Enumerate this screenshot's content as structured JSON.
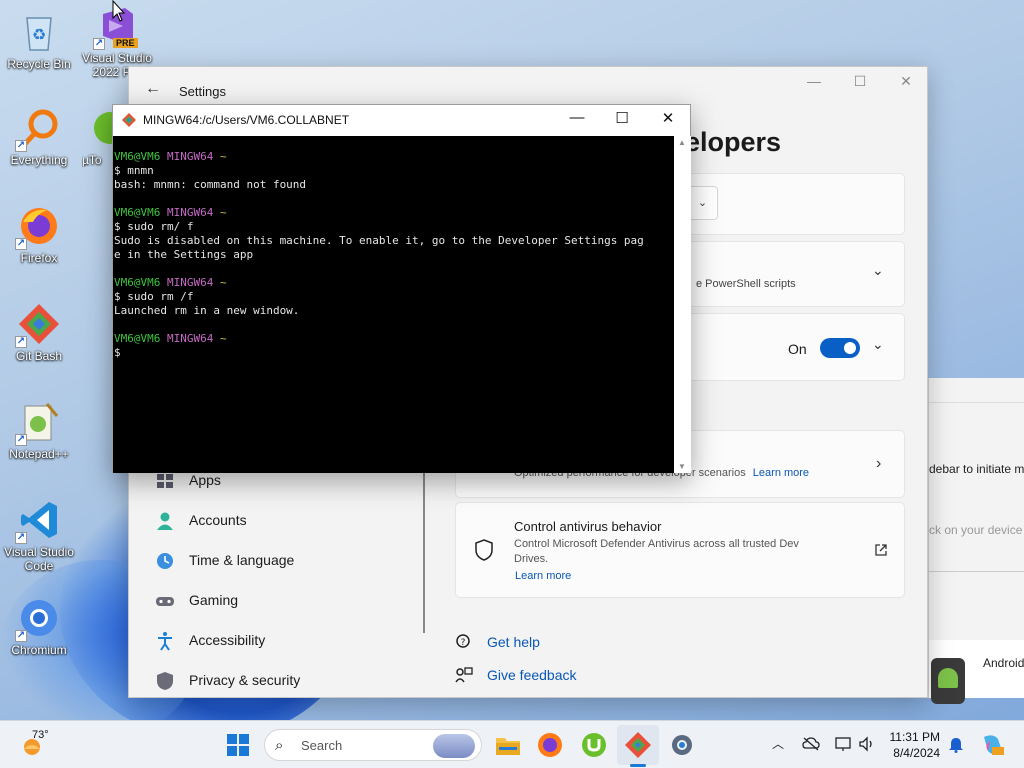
{
  "desktop": {
    "icons": [
      {
        "label": "Recycle Bin",
        "icon": "recycle-bin-icon"
      },
      {
        "label": "Visual Studio 2022 Pre",
        "icon": "visual-studio-2022-icon",
        "badge": "PRE"
      },
      {
        "label": "Everything",
        "icon": "everything-search-icon"
      },
      {
        "label": "µTo",
        "icon": "utorrent-icon"
      },
      {
        "label": "Firefox",
        "icon": "firefox-icon"
      },
      {
        "label": "Git Bash",
        "icon": "git-bash-icon"
      },
      {
        "label": "Notepad++",
        "icon": "notepad-plus-plus-icon"
      },
      {
        "label": "Visual Studio Code",
        "icon": "vscode-icon"
      },
      {
        "label": "Chromium",
        "icon": "chromium-icon"
      }
    ]
  },
  "settings": {
    "title": "Settings",
    "heading": "elopers",
    "cards": {
      "scripts_text": "e PowerShell scripts",
      "toggle_state": "On",
      "devdrive_desc": "Optimized performance for developer scenarios",
      "learn_more": "Learn more",
      "antivirus_title": "Control antivirus behavior",
      "antivirus_desc_1": "Control Microsoft Defender Antivirus across all trusted Dev",
      "antivirus_desc_2": "Drives.",
      "antivirus_learn_more": "Learn more"
    },
    "nav": [
      {
        "label": "Apps",
        "icon": "apps-icon"
      },
      {
        "label": "Accounts",
        "icon": "accounts-icon"
      },
      {
        "label": "Time & language",
        "icon": "time-language-icon"
      },
      {
        "label": "Gaming",
        "icon": "gaming-icon"
      },
      {
        "label": "Accessibility",
        "icon": "accessibility-icon"
      },
      {
        "label": "Privacy & security",
        "icon": "privacy-shield-icon"
      }
    ],
    "help": {
      "get_help": "Get help",
      "give_feedback": "Give feedback"
    }
  },
  "background_window": {
    "text_1": "debar to initiate m",
    "text_2": "ck on your device",
    "text_3": "Android"
  },
  "terminal": {
    "title": "MINGW64:/c/Users/VM6.COLLABNET",
    "lines": [
      {
        "user": "VM6@VM6",
        "env": "MINGW64",
        "path": "~"
      },
      {
        "text": "$ mnmn"
      },
      {
        "text": "bash: mnmn: command not found"
      },
      {
        "text": ""
      },
      {
        "user": "VM6@VM6",
        "env": "MINGW64",
        "path": "~"
      },
      {
        "text": "$ sudo rm/ f"
      },
      {
        "text": "Sudo is disabled on this machine. To enable it, go to the Developer Settings pag"
      },
      {
        "text": "e in the Settings app"
      },
      {
        "text": ""
      },
      {
        "user": "VM6@VM6",
        "env": "MINGW64",
        "path": "~"
      },
      {
        "text": "$ sudo rm /f"
      },
      {
        "text": "Launched rm in a new window."
      },
      {
        "text": ""
      },
      {
        "user": "VM6@VM6",
        "env": "MINGW64",
        "path": "~"
      },
      {
        "text": "$"
      }
    ]
  },
  "taskbar": {
    "weather": "73°",
    "search_placeholder": "Search",
    "time": "11:31 PM",
    "date": "8/4/2024",
    "apps": [
      "start-icon",
      "file-explorer-icon",
      "firefox-icon",
      "utorrent-icon",
      "git-bash-icon",
      "settings-gear-icon"
    ]
  }
}
